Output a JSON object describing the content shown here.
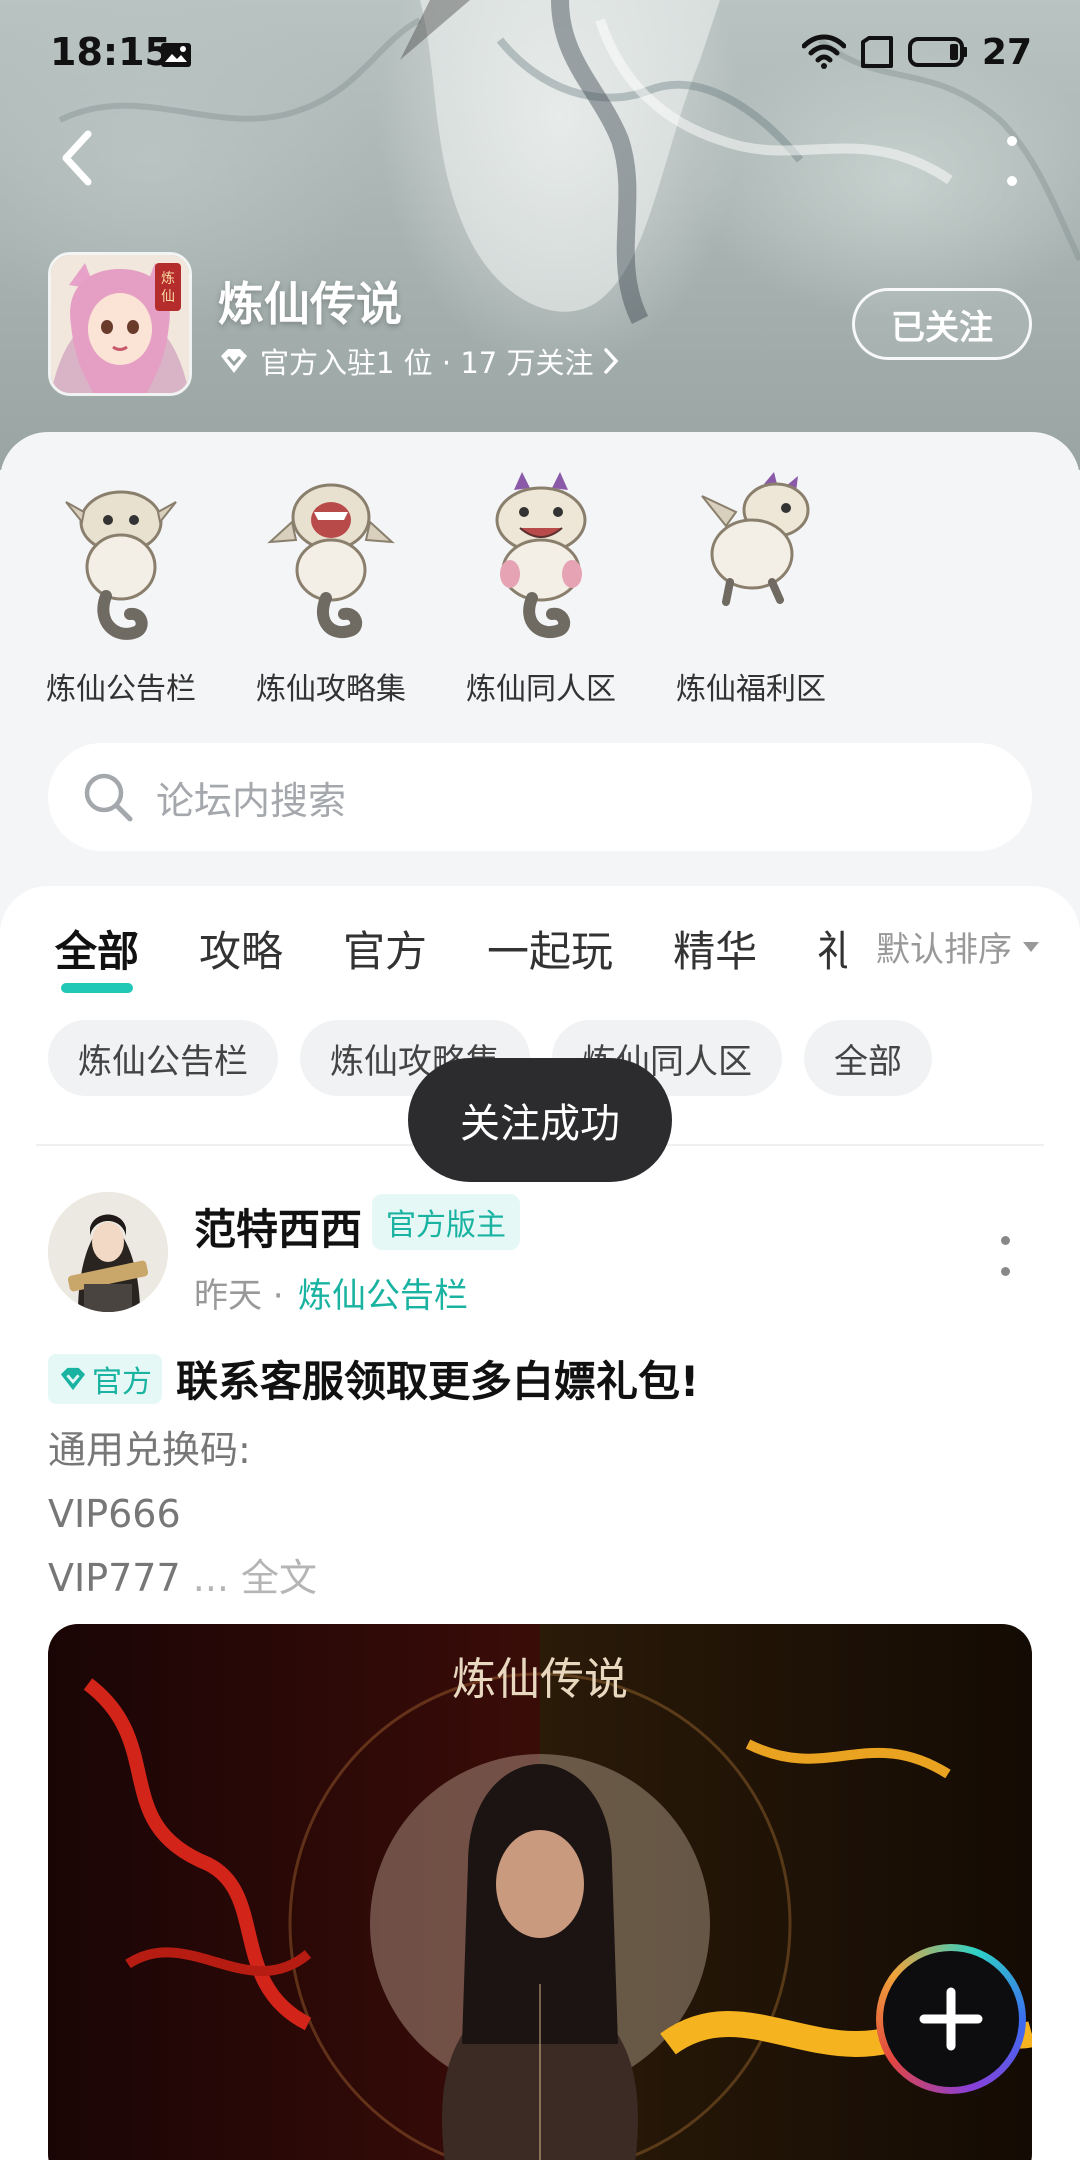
{
  "status_bar": {
    "time": "18:15",
    "battery": "27"
  },
  "header": {
    "title": "炼仙传说",
    "meta": "官方入驻1 位 · 17 万关注",
    "follow_label": "已关注"
  },
  "sub_forums": [
    {
      "label": "炼仙公告栏"
    },
    {
      "label": "炼仙攻略集"
    },
    {
      "label": "炼仙同人区"
    },
    {
      "label": "炼仙福利区"
    }
  ],
  "search": {
    "placeholder": "论坛内搜索"
  },
  "tabs": [
    {
      "label": "全部",
      "active": true
    },
    {
      "label": "攻略"
    },
    {
      "label": "官方"
    },
    {
      "label": "一起玩"
    },
    {
      "label": "精华"
    },
    {
      "label": "礼"
    }
  ],
  "sort_label": "默认排序",
  "chips": [
    "炼仙公告栏",
    "炼仙攻略集",
    "炼仙同人区",
    "全部"
  ],
  "toast": "关注成功",
  "post": {
    "author": "范特西西",
    "role": "官方版主",
    "time": "昨天 ·",
    "forum": "炼仙公告栏",
    "badge": "官方",
    "title": "联系客服领取更多白嫖礼包!",
    "body_lines": [
      "通用兑换码:",
      "VIP666",
      "VIP777"
    ],
    "ellipsis": " ... 全文",
    "image_logo_text": "炼仙传说"
  },
  "colors": {
    "accent": "#1ab3a2",
    "tab_underline": "#21c8b6",
    "toast_bg": "#2c2c2e"
  },
  "icons": [
    "image-icon",
    "wifi-icon",
    "sim-icon",
    "battery-icon",
    "back-icon",
    "more-icon",
    "diamond-icon",
    "chevron-right-icon",
    "search-icon",
    "caret-down-icon",
    "plus-icon"
  ]
}
